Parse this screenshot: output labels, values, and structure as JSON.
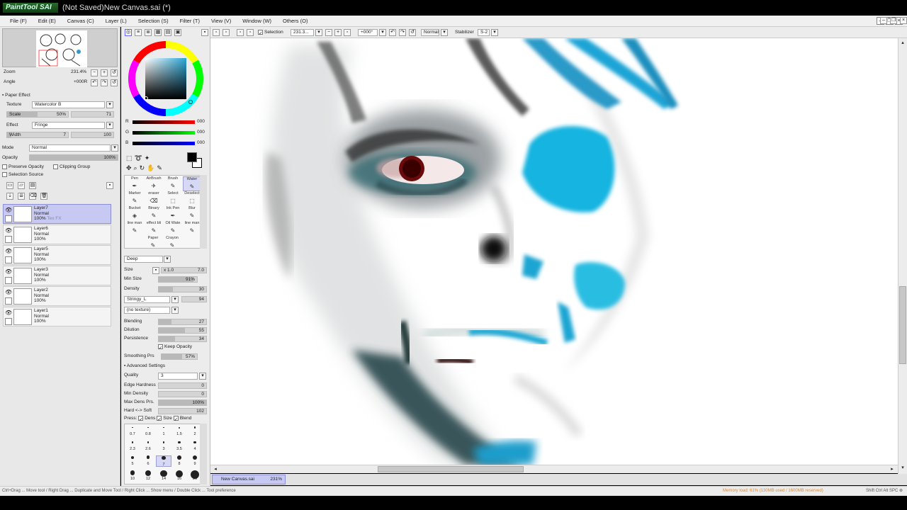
{
  "window": {
    "app_logo": "PaintTool SAI",
    "title": "(Not Saved)New Canvas.sai (*)"
  },
  "menu": [
    "File (F)",
    "Edit (E)",
    "Canvas (C)",
    "Layer (L)",
    "Selection (S)",
    "Filter (T)",
    "View (V)",
    "Window (W)",
    "Others (O)"
  ],
  "navigator": {
    "zoom_label": "Zoom",
    "zoom_value": "231.4%",
    "angle_label": "Angle",
    "angle_value": "+000R"
  },
  "paper_effect": {
    "title": "Paper Effect",
    "texture_label": "Texture",
    "texture_value": "Watercolor B",
    "scale_label": "Scale",
    "scale_pct": "50%",
    "scale_value": "71",
    "scale_fill": 0.5,
    "effect_label": "Effect",
    "effect_value": "Fringe",
    "width_label": "Width",
    "width_value": "7",
    "width_max": "100",
    "width_fill": 0.07
  },
  "layer_props": {
    "mode_label": "Mode",
    "mode_value": "Normal",
    "opacity_label": "Opacity",
    "opacity_value": "100%",
    "opacity_fill": 1.0,
    "preserve_opacity": "Preserve Opacity",
    "clipping_group": "Clipping Group",
    "selection_source": "Selection Source"
  },
  "layers": [
    {
      "name": "Layer7",
      "mode": "Normal",
      "opacity": "100%",
      "fx": "Tex FX",
      "selected": true
    },
    {
      "name": "Layer6",
      "mode": "Normal",
      "opacity": "100%",
      "fx": "",
      "selected": false
    },
    {
      "name": "Layer5",
      "mode": "Normal",
      "opacity": "100%",
      "fx": "",
      "selected": false
    },
    {
      "name": "Layer3",
      "mode": "Normal",
      "opacity": "100%",
      "fx": "",
      "selected": false
    },
    {
      "name": "Layer2",
      "mode": "Normal",
      "opacity": "100%",
      "fx": "",
      "selected": false
    },
    {
      "name": "Layer1",
      "mode": "Normal",
      "opacity": "100%",
      "fx": "",
      "selected": false
    }
  ],
  "colors": {
    "r_label": "R",
    "r_value": "000",
    "g_label": "G",
    "g_value": "000",
    "b_label": "B",
    "b_value": "000",
    "primary": "#000000",
    "secondary": "#ffffff"
  },
  "tools": [
    {
      "label": "Pen",
      "selected": false
    },
    {
      "label": "AirBrush",
      "selected": false
    },
    {
      "label": "Brush",
      "selected": false
    },
    {
      "label": "Water",
      "selected": true
    },
    {
      "label": "Marker",
      "selected": false
    },
    {
      "label": "eraser",
      "selected": false
    },
    {
      "label": "Select",
      "selected": false
    },
    {
      "label": "Deselect",
      "selected": false
    },
    {
      "label": "Bucket",
      "selected": false
    },
    {
      "label": "Binary",
      "selected": false
    },
    {
      "label": "Ink Pen",
      "selected": false
    },
    {
      "label": "Blur",
      "selected": false
    },
    {
      "label": "line man",
      "selected": false
    },
    {
      "label": "effect bli",
      "selected": false
    },
    {
      "label": "Oil Wate",
      "selected": false
    },
    {
      "label": "line man",
      "selected": false
    },
    {
      "label": "Paper",
      "selected": false
    },
    {
      "label": "Crayon",
      "selected": false
    }
  ],
  "brush": {
    "shape_value": "Deep",
    "size_label": "Size",
    "size_mult": "x 1.0",
    "size_value": "7.0",
    "min_size_label": "Min Size",
    "min_size_value": "91%",
    "min_size_fill": 0.91,
    "density_label": "Density",
    "density_value": "30",
    "density_fill": 0.3,
    "texture1_value": "Stringy_L",
    "texture1_amount": "94",
    "texture2_value": "(no texture)",
    "blending_label": "Blending",
    "blending_value": "27",
    "blending_fill": 0.27,
    "dilution_label": "Dilution",
    "dilution_value": "55",
    "dilution_fill": 0.55,
    "persistence_label": "Persistence",
    "persistence_value": "34",
    "persistence_fill": 0.34,
    "keep_opacity": "Keep Opacity",
    "smoothing_label": "Smoothing Prs",
    "smoothing_value": "57%",
    "smoothing_fill": 0.57,
    "advanced_label": "Advanced Settings",
    "quality_label": "Quality",
    "quality_value": "3",
    "edge_label": "Edge Hardness",
    "edge_value": "0",
    "min_density_label": "Min Density",
    "min_density_value": "0",
    "max_dens_label": "Max Dens Prs.",
    "max_dens_value": "100%",
    "max_dens_fill": 1.0,
    "hardsoft_label": "Hard <-> Soft",
    "hardsoft_value": "102",
    "press_label": "Press:",
    "press_dens": "Dens",
    "press_size": "Size",
    "press_blend": "Blend"
  },
  "brush_sizes": [
    "0.7",
    "0.8",
    "1",
    "1.5",
    "2",
    "2.3",
    "2.6",
    "3",
    "3.5",
    "4",
    "5",
    "6",
    "7",
    "8",
    "9",
    "10",
    "12",
    "14",
    "16",
    "20"
  ],
  "canvas_toolbar": {
    "selection_label": "Selection",
    "zoom_value": "231.3...",
    "angle_value": "+000°",
    "blend_mode": "Normal",
    "stabilizer_label": "Stabilizer",
    "stabilizer_value": "S-2"
  },
  "canvas_tab": {
    "name": "New Canvas.sai",
    "zoom": "231%"
  },
  "status": {
    "hint": "Ctrl+Drag ... Move tool / Right Drag ... Duplicate and Move Tool / Right Click ... Show menu / Double Click ... Tool preference",
    "memory": "Memory load: 61% (130MB used / 1600MB reserved)",
    "keys": "Shift Ctrl Alt SPC ⊕ Any"
  }
}
